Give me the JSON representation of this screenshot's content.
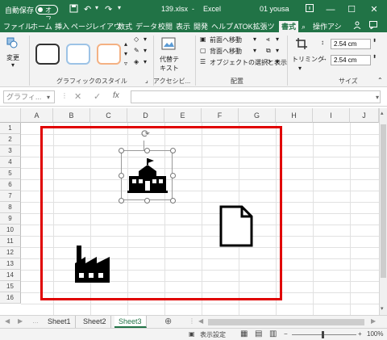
{
  "titlebar": {
    "autosave_label": "自動保存",
    "autosave_state": "オフ",
    "filename": "139.xlsx",
    "app": "Excel",
    "user": "01 yousa"
  },
  "tabs": [
    "ファイル",
    "ホーム",
    "挿入",
    "ページ",
    "レイアウ",
    "数式",
    "データ",
    "校閲",
    "表示",
    "開発",
    "ヘルプ",
    "ATOK拡張ツ",
    "書式",
    "操作アシ"
  ],
  "active_tab": "書式",
  "ribbon": {
    "change_label": "変更",
    "shape_styles_label": "グラフィックのスタイル",
    "alt_text_label": "代替テ\nキスト",
    "accessibility_label": "アクセシビ...",
    "bring_forward": "前面へ移動",
    "send_backward": "背面へ移動",
    "selection_pane": "オブジェクトの選択と表示",
    "arrange_label": "配置",
    "crop_label": "トリミング",
    "height": "2.54 cm",
    "width": "2.54 cm",
    "size_label": "サイズ"
  },
  "formula_bar": {
    "name_box": "グラフィ...",
    "fx": "fx"
  },
  "columns": [
    "A",
    "B",
    "C",
    "D",
    "E",
    "F",
    "G",
    "H",
    "I",
    "J"
  ],
  "rows": [
    "1",
    "2",
    "3",
    "4",
    "5",
    "6",
    "7",
    "8",
    "9",
    "10",
    "11",
    "12",
    "13",
    "14",
    "15",
    "16"
  ],
  "sheets": [
    "Sheet1",
    "Sheet2",
    "Sheet3"
  ],
  "active_sheet": "Sheet3",
  "status": {
    "display_settings": "表示設定",
    "zoom": "100%"
  },
  "colors": {
    "accent": "#217346",
    "frame": "#e00000"
  }
}
